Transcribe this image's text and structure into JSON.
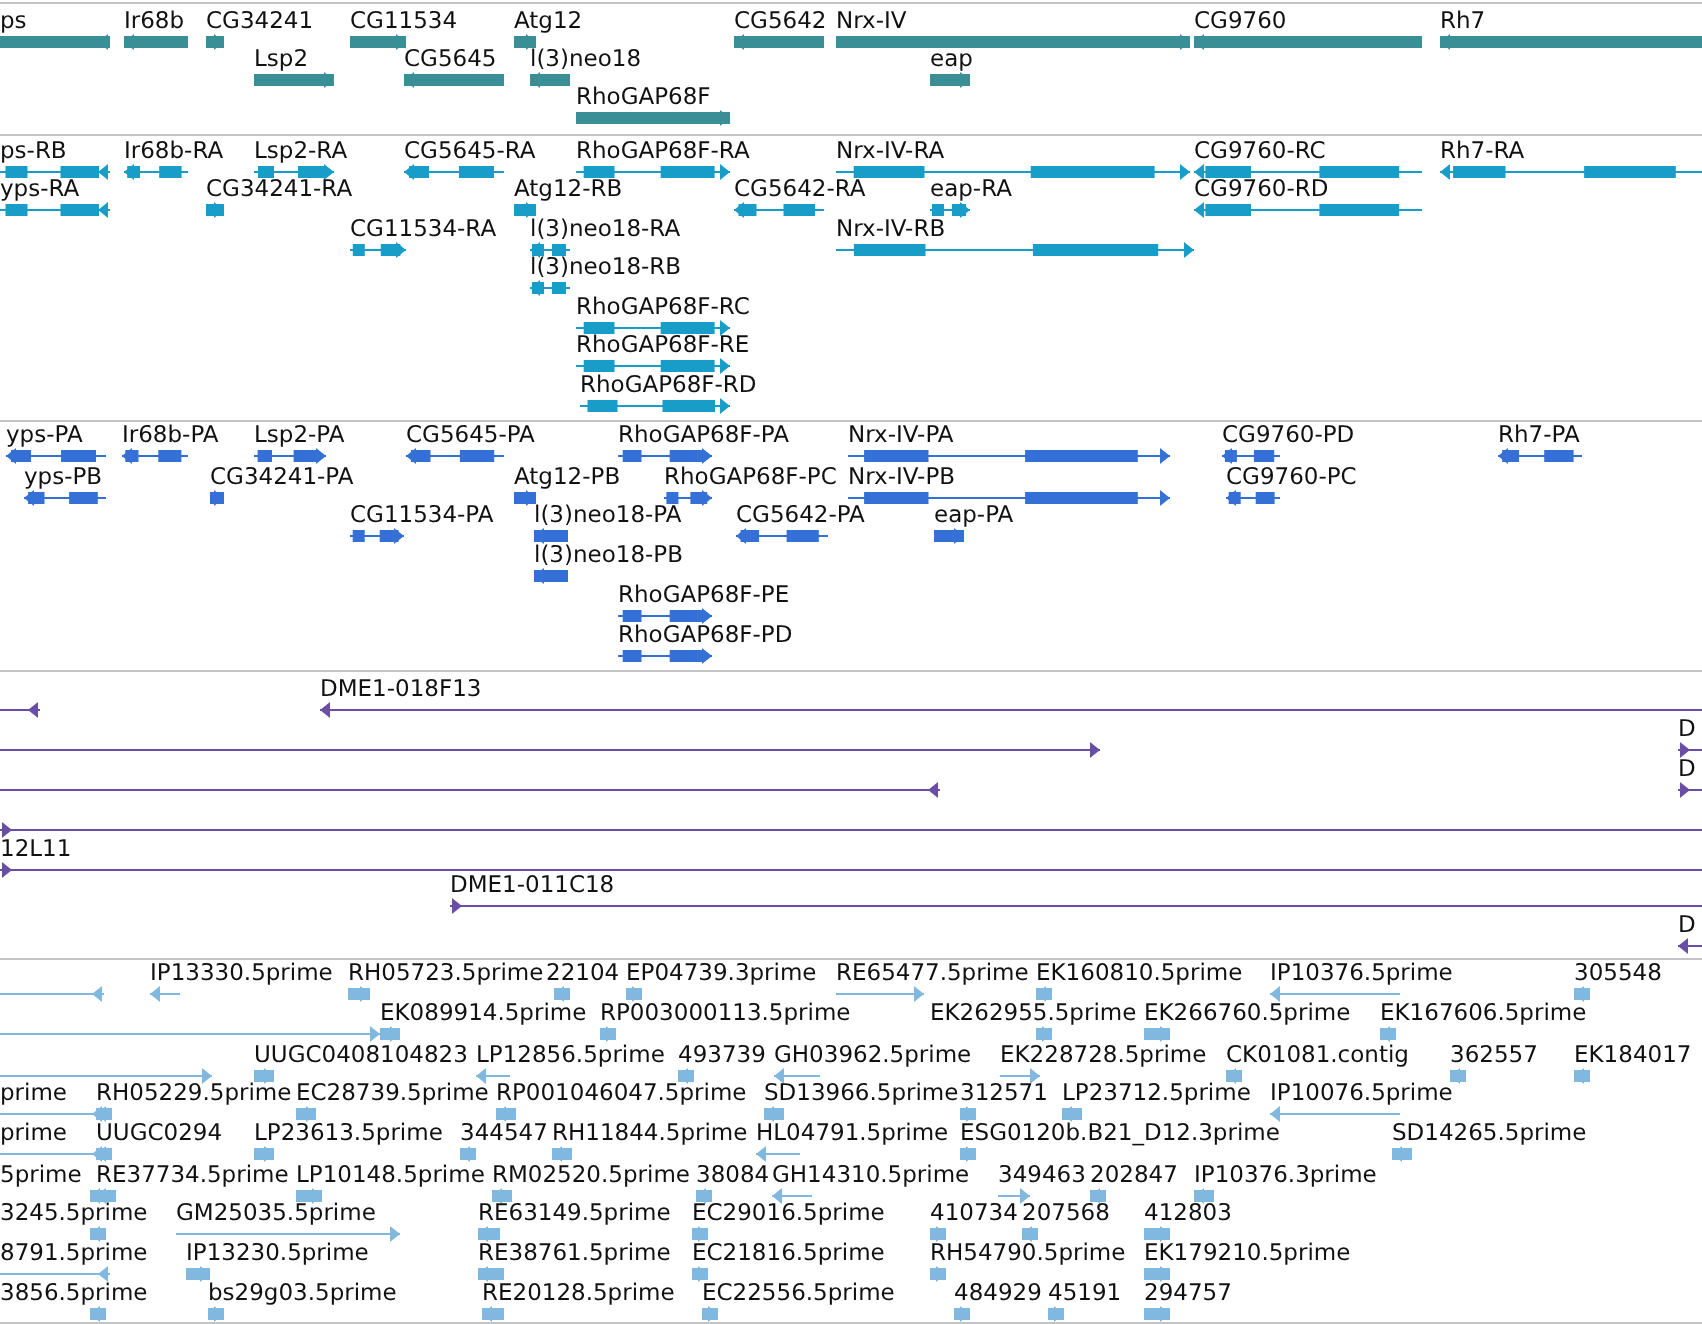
{
  "tracks": [
    {
      "kind": "gene",
      "color": "#3a8f96",
      "features": [
        {
          "label": "ps",
          "reverse": true
        },
        {
          "label": "Ir68b",
          "reverse": true
        },
        {
          "label": "CG34241",
          "reverse": false
        },
        {
          "label": "CG11534",
          "reverse": false
        },
        {
          "label": "Atg12",
          "reverse": false
        },
        {
          "label": "CG5642",
          "reverse": true
        },
        {
          "label": "Nrx-IV",
          "reverse": false
        },
        {
          "label": "CG9760",
          "reverse": true
        },
        {
          "label": "Rh7",
          "reverse": true
        },
        {
          "label": "Lsp2",
          "reverse": false
        },
        {
          "label": "CG5645",
          "reverse": true
        },
        {
          "label": "l(3)neo18",
          "reverse": true
        },
        {
          "label": "eap",
          "reverse": false
        },
        {
          "label": "RhoGAP68F",
          "reverse": false
        }
      ]
    },
    {
      "kind": "transcript",
      "color": "#189dc8",
      "features": [
        {
          "label": "ps-RB",
          "reverse": true
        },
        {
          "label": "Ir68b-RA",
          "reverse": true
        },
        {
          "label": "Lsp2-RA",
          "reverse": false
        },
        {
          "label": "CG5645-RA",
          "reverse": true
        },
        {
          "label": "RhoGAP68F-RA",
          "reverse": false
        },
        {
          "label": "Nrx-IV-RA",
          "reverse": false
        },
        {
          "label": "CG9760-RC",
          "reverse": true
        },
        {
          "label": "Rh7-RA",
          "reverse": true
        },
        {
          "label": "yps-RA",
          "reverse": true
        },
        {
          "label": "CG34241-RA",
          "reverse": false
        },
        {
          "label": "Atg12-RB",
          "reverse": false
        },
        {
          "label": "CG5642-RA",
          "reverse": true
        },
        {
          "label": "eap-RA",
          "reverse": false
        },
        {
          "label": "CG9760-RD",
          "reverse": true
        },
        {
          "label": "CG11534-RA",
          "reverse": false
        },
        {
          "label": "l(3)neo18-RA",
          "reverse": true
        },
        {
          "label": "Nrx-IV-RB",
          "reverse": false
        },
        {
          "label": "l(3)neo18-RB",
          "reverse": true
        },
        {
          "label": "RhoGAP68F-RC",
          "reverse": false
        },
        {
          "label": "RhoGAP68F-RE",
          "reverse": false
        },
        {
          "label": "RhoGAP68F-RD",
          "reverse": false
        }
      ]
    },
    {
      "kind": "protein",
      "color": "#3470d6",
      "features": [
        {
          "label": "yps-PA",
          "reverse": true
        },
        {
          "label": "Ir68b-PA",
          "reverse": true
        },
        {
          "label": "Lsp2-PA",
          "reverse": false
        },
        {
          "label": "CG5645-PA",
          "reverse": true
        },
        {
          "label": "RhoGAP68F-PA",
          "reverse": false
        },
        {
          "label": "Nrx-IV-PA",
          "reverse": false
        },
        {
          "label": "CG9760-PD",
          "reverse": true
        },
        {
          "label": "Rh7-PA",
          "reverse": true
        },
        {
          "label": "yps-PB",
          "reverse": true
        },
        {
          "label": "CG34241-PA",
          "reverse": false
        },
        {
          "label": "Atg12-PB",
          "reverse": false
        },
        {
          "label": "RhoGAP68F-PC",
          "reverse": false
        },
        {
          "label": "Nrx-IV-PB",
          "reverse": false
        },
        {
          "label": "CG9760-PC",
          "reverse": true
        },
        {
          "label": "CG11534-PA",
          "reverse": false
        },
        {
          "label": "l(3)neo18-PA",
          "reverse": true
        },
        {
          "label": "CG5642-PA",
          "reverse": true
        },
        {
          "label": "eap-PA",
          "reverse": false
        },
        {
          "label": "l(3)neo18-PB",
          "reverse": true
        },
        {
          "label": "RhoGAP68F-PE",
          "reverse": false
        },
        {
          "label": "RhoGAP68F-PD",
          "reverse": false
        }
      ]
    },
    {
      "kind": "clone",
      "color": "#6a4ea3",
      "features": [
        {
          "reverse": true
        },
        {
          "label": "DME1-018F13",
          "reverse": true
        },
        {
          "reverse": false
        },
        {
          "label": "D",
          "reverse": false
        },
        {
          "reverse": true
        },
        {
          "label": "D",
          "reverse": false
        },
        {
          "reverse": false
        },
        {
          "label": "12L11",
          "reverse": false
        },
        {
          "label": "DME1-011C18",
          "reverse": false
        },
        {
          "label": "D",
          "reverse": true
        }
      ]
    },
    {
      "kind": "est",
      "color": "#80b8e0",
      "features": [
        {
          "reverse": true
        },
        {
          "label": "IP13330.5prime",
          "reverse": true
        },
        {
          "label": "RH05723.5prime",
          "reverse": false
        },
        {
          "label": "22104",
          "reverse": true
        },
        {
          "label": "EP04739.3prime",
          "reverse": false
        },
        {
          "label": "RE65477.5prime",
          "reverse": false
        },
        {
          "label": "EK160810.5prime",
          "reverse": true
        },
        {
          "label": "IP10376.5prime",
          "reverse": true
        },
        {
          "label": "305548",
          "reverse": true
        },
        {
          "reverse": false
        },
        {
          "label": "EK089914.5prime",
          "reverse": false
        },
        {
          "label": "RP003000113.5prime",
          "reverse": false
        },
        {
          "label": "EK262955.5prime",
          "reverse": false
        },
        {
          "label": "EK266760.5prime",
          "reverse": false
        },
        {
          "label": "EK167606.5prime",
          "reverse": true
        },
        {
          "reverse": false
        },
        {
          "label": "UUGC0408104823",
          "reverse": false
        },
        {
          "label": "LP12856.5prime",
          "reverse": true
        },
        {
          "label": "493739",
          "reverse": true
        },
        {
          "label": "GH03962.5prime",
          "reverse": true
        },
        {
          "label": "EK228728.5prime",
          "reverse": false
        },
        {
          "label": "CK01081.contig",
          "reverse": true
        },
        {
          "label": "362557",
          "reverse": true
        },
        {
          "label": "EK184017",
          "reverse": true
        },
        {
          "label": "prime",
          "reverse": true
        },
        {
          "label": "RH05229.5prime",
          "reverse": true
        },
        {
          "label": "EC28739.5prime",
          "reverse": false
        },
        {
          "label": "RP001046047.5prime",
          "reverse": true
        },
        {
          "label": "SD13966.5prime",
          "reverse": true
        },
        {
          "label": "312571",
          "reverse": false
        },
        {
          "label": "LP23712.5prime",
          "reverse": true
        },
        {
          "label": "IP10076.5prime",
          "reverse": true
        },
        {
          "label": "prime",
          "reverse": true
        },
        {
          "label": "UUGC0294",
          "reverse": true
        },
        {
          "label": "LP23613.5prime",
          "reverse": false
        },
        {
          "label": "344547",
          "reverse": true
        },
        {
          "label": "RH11844.5prime",
          "reverse": true
        },
        {
          "label": "HL04791.5prime",
          "reverse": true
        },
        {
          "label": "ESG0120b.B21_D12.3prime",
          "reverse": false
        },
        {
          "label": "SD14265.5prime",
          "reverse": true
        },
        {
          "label": "5prime",
          "reverse": true
        },
        {
          "label": "RE37734.5prime",
          "reverse": true
        },
        {
          "label": "LP10148.5prime",
          "reverse": false
        },
        {
          "label": "RM02520.5prime",
          "reverse": true
        },
        {
          "label": "38084",
          "reverse": true
        },
        {
          "label": "GH14310.5prime",
          "reverse": true
        },
        {
          "label": "349463",
          "reverse": false
        },
        {
          "label": "202847",
          "reverse": true
        },
        {
          "label": "IP10376.3prime",
          "reverse": true
        },
        {
          "label": "3245.5prime",
          "reverse": true
        },
        {
          "label": "GM25035.5prime",
          "reverse": false
        },
        {
          "label": "RE63149.5prime",
          "reverse": true
        },
        {
          "label": "EC29016.5prime",
          "reverse": false
        },
        {
          "label": "410734",
          "reverse": false
        },
        {
          "label": "207568",
          "reverse": true
        },
        {
          "label": "412803",
          "reverse": false
        },
        {
          "label": "8791.5prime",
          "reverse": true
        },
        {
          "label": "IP13230.5prime",
          "reverse": false
        },
        {
          "label": "RE38761.5prime",
          "reverse": true
        },
        {
          "label": "EC21816.5prime",
          "reverse": false
        },
        {
          "label": "RH54790.5prime",
          "reverse": false
        },
        {
          "label": "EK179210.5prime",
          "reverse": false
        },
        {
          "label": "3856.5prime",
          "reverse": true
        },
        {
          "label": "bs29g03.5prime",
          "reverse": false
        },
        {
          "label": "RE20128.5prime",
          "reverse": true
        },
        {
          "label": "EC22556.5prime",
          "reverse": false
        },
        {
          "label": "484929",
          "reverse": false
        },
        {
          "label": "45191",
          "reverse": false
        },
        {
          "label": "294757",
          "reverse": false
        }
      ]
    }
  ]
}
